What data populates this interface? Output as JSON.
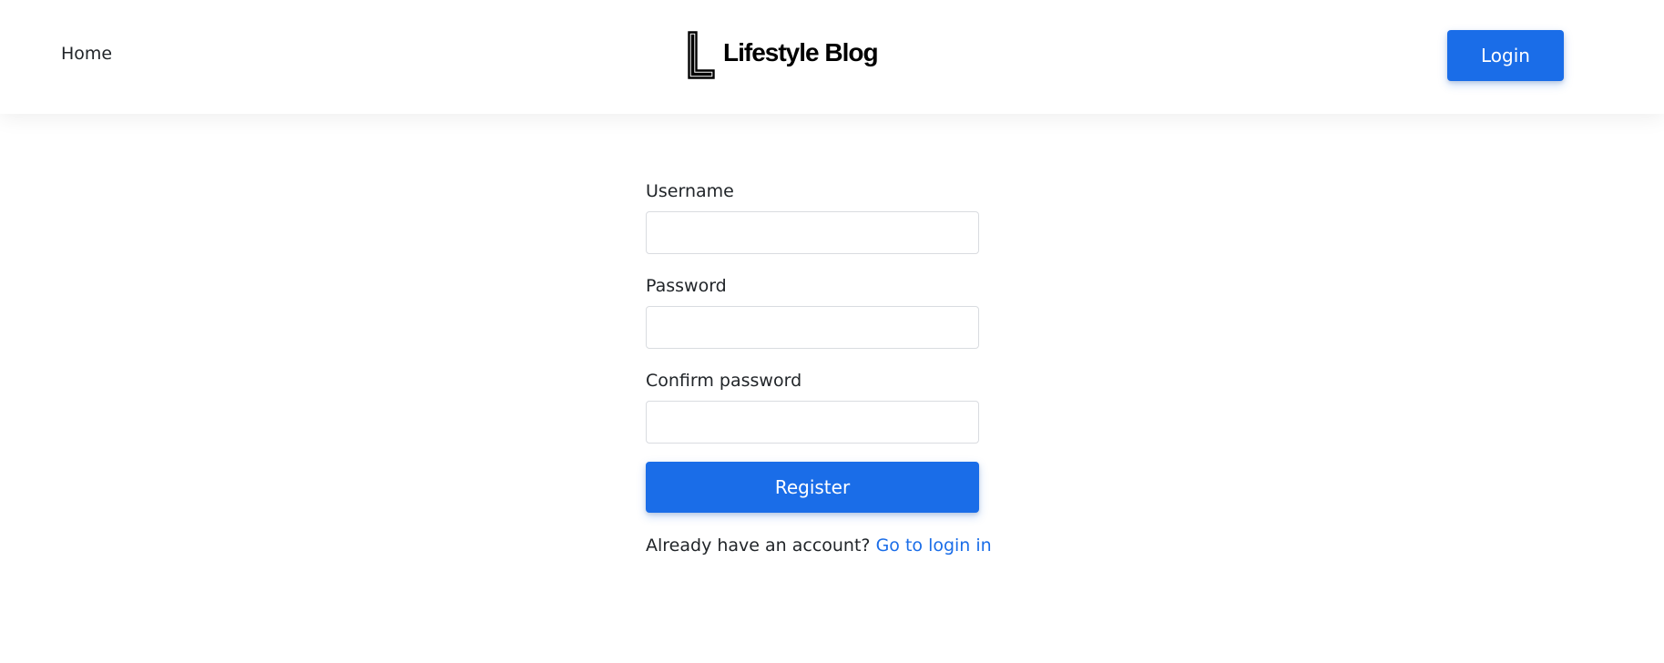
{
  "navbar": {
    "home_label": "Home",
    "brand_name": "Lifestyle Blog",
    "brand_logo_icon": "letter-l-logo-icon",
    "login_label": "Login"
  },
  "form": {
    "username_label": "Username",
    "username_value": "",
    "password_label": "Password",
    "password_value": "",
    "confirm_label": "Confirm password",
    "confirm_value": "",
    "register_label": "Register",
    "alt_prompt": "Already have an account?",
    "alt_link": "Go to login in"
  },
  "colors": {
    "primary": "#1a6de8",
    "text": "#212529",
    "background": "#ffffff"
  }
}
